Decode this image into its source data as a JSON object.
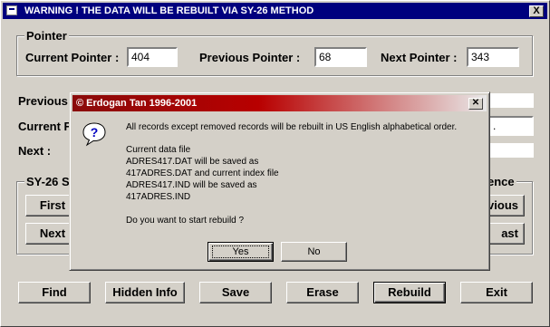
{
  "window": {
    "title": "WARNING !  THE DATA WILL BE REBUILT VIA SY-26 METHOD",
    "close_glyph": "X"
  },
  "pointer_group": {
    "title": "Pointer",
    "current_label": "Current Pointer :",
    "current_value": "404",
    "previous_label": "Previous Pointer :",
    "previous_value": "68",
    "next_label": "Next Pointer :",
    "next_value": "343"
  },
  "partial_labels": {
    "previous": "Previous",
    "current": "Current F",
    "next": "Next :",
    "current_right_fragment": "."
  },
  "sy26_group": {
    "title": "SY-26 S",
    "first_button": "First",
    "next_button": "Next"
  },
  "sequence_group": {
    "title": "ence",
    "previous_button": "vious",
    "last_button": "ast"
  },
  "toolbar": {
    "find": "Find",
    "hidden_info": "Hidden Info",
    "save": "Save",
    "erase": "Erase",
    "rebuild": "Rebuild",
    "exit": "Exit"
  },
  "dialog": {
    "title": "© Erdogan Tan  1996-2001",
    "close_glyph": "✕",
    "icon": "question-icon",
    "message_lines": [
      "All records except removed records will be rebuilt in US English alphabetical order.",
      "Current data file",
      "ADRES417.DAT will be saved as",
      "417ADRES.DAT and current index file",
      "ADRES417.IND will be saved as",
      "417ADRES.IND",
      "Do you want to start rebuild ?"
    ],
    "yes_label": "Yes",
    "no_label": "No"
  },
  "colors": {
    "titlebar": "#00007e",
    "dialog_title_start": "#8a0a0a",
    "face": "#d4d0c8"
  }
}
